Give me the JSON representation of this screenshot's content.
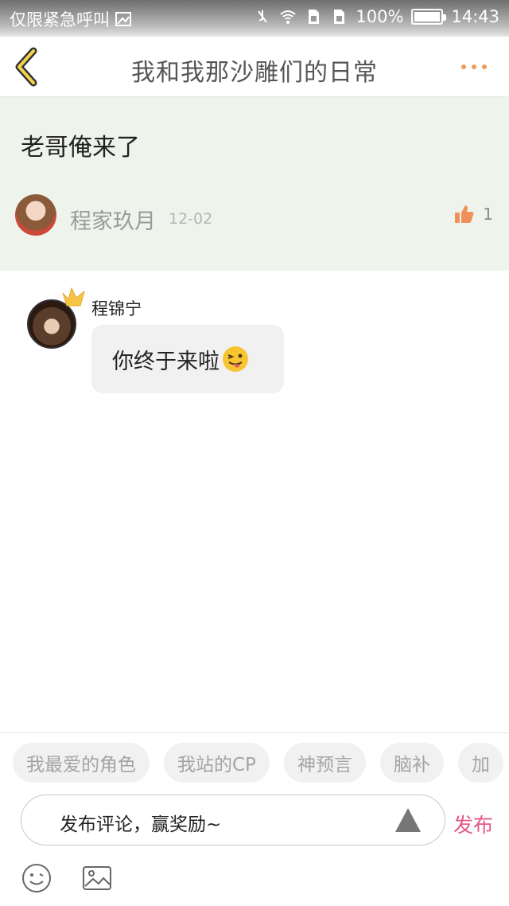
{
  "status_bar": {
    "carrier": "仅限紧急呼叫",
    "battery_percent": "100%",
    "battery_level": 1.0,
    "time": "14:43"
  },
  "header": {
    "title": "我和我那沙雕们的日常",
    "back_icon": "chevron-left-icon",
    "more_icon": "more-dots-icon",
    "accent_color": "#f29a55"
  },
  "post": {
    "text": "老哥俺来了",
    "author": "程家玖月",
    "date": "12-02",
    "likes": "1",
    "like_icon": "thumbs-up-icon",
    "background_color": "#eef4ec"
  },
  "reply": {
    "author": "程锦宁",
    "text": "你终于来啦",
    "emoji": "tongue-out-emoji"
  },
  "footer": {
    "tags": [
      "我最爱的角色",
      "我站的CP",
      "神预言",
      "脑补",
      "加"
    ],
    "input_placeholder": "发布评论，赢奖励~",
    "publish_label": "发布",
    "publish_color": "#e4578a",
    "icons": [
      "smiley-icon",
      "image-icon",
      "triangle-up-icon"
    ]
  }
}
